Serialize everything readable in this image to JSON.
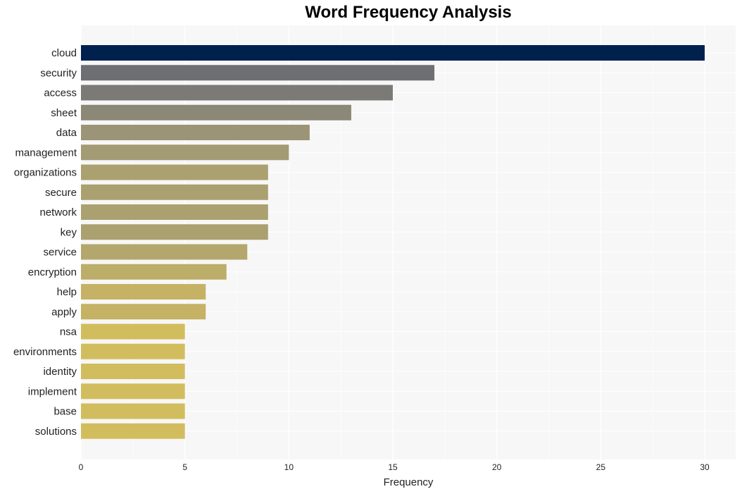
{
  "chart_data": {
    "type": "bar",
    "orientation": "horizontal",
    "title": "Word Frequency Analysis",
    "xlabel": "Frequency",
    "ylabel": "",
    "xlim": [
      0,
      31.5
    ],
    "xticks": [
      0,
      5,
      10,
      15,
      20,
      25,
      30
    ],
    "grid": true,
    "categories": [
      "cloud",
      "security",
      "access",
      "sheet",
      "data",
      "management",
      "organizations",
      "secure",
      "network",
      "key",
      "service",
      "encryption",
      "help",
      "apply",
      "nsa",
      "environments",
      "identity",
      "implement",
      "base",
      "solutions"
    ],
    "values": [
      30,
      17,
      15,
      13,
      11,
      10,
      9,
      9,
      9,
      9,
      8,
      7,
      6,
      6,
      5,
      5,
      5,
      5,
      5,
      5
    ],
    "colors": [
      "#00204e",
      "#6e6f73",
      "#7b7a77",
      "#8c8878",
      "#9c9476",
      "#a39b74",
      "#aba06f",
      "#aba06f",
      "#aba06f",
      "#aba06f",
      "#b4a76d",
      "#bcad69",
      "#c5b264",
      "#c5b264",
      "#d2bd5e",
      "#d2bd5e",
      "#d2bd5e",
      "#d2bd5e",
      "#d2bd5e",
      "#d2bd5e"
    ]
  }
}
